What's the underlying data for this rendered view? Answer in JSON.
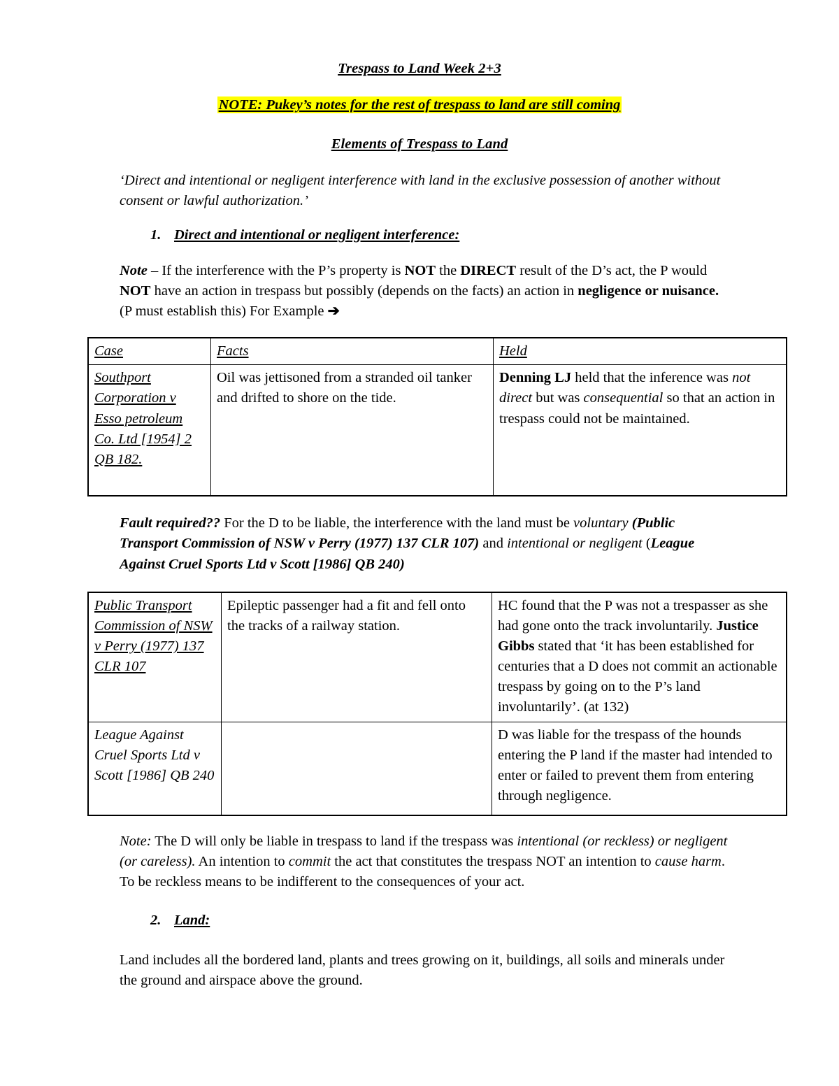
{
  "document": {
    "title": "Trespass to Land Week 2+3",
    "highlight_note": "NOTE: Pukey’s notes for the rest of trespass to land are still coming",
    "highlight_color": "#ffff00",
    "section_heading": "Elements of Trespass to Land",
    "definition_line1": "‘Direct and intentional or negligent interference with land in the exclusive possession of",
    "definition_line2": "another without consent or lawful authorization.’"
  },
  "elements": [
    {
      "number": "1.",
      "label": "Direct and intentional or negligent interference:"
    },
    {
      "number": "2.",
      "label": "Land:"
    }
  ],
  "note_paragraph": {
    "lead": "Note",
    "dash": " – If the interference with the P’s property is ",
    "not1": "NOT",
    "the": " the ",
    "direct": "DIRECT",
    "rest1": " result of the D’s act, the P would ",
    "not2": "NOT",
    "rest2": " have an action in trespass but possibly (depends on the facts) an action in ",
    "negligence": "negligence or nuisance.",
    "rest3": " (P must establish this) For Example ",
    "arrow": "➔"
  },
  "table_one": {
    "headers": [
      "Case",
      "Facts",
      "Held"
    ],
    "rows": [
      {
        "case": "Southport Corporation v Esso petroleum Co. Ltd [1954] 2 QB 182.",
        "facts": "Oil was jettisoned from a stranded oil tanker and drifted to shore on the tide.",
        "held_bold": "Denning LJ",
        "held_part1": " held that the inference was ",
        "held_italic1": "not direct",
        "held_part2": " but was ",
        "held_italic2": "consequential",
        "held_part3": " so that an action in trespass could not be maintained."
      }
    ]
  },
  "fault_paragraph": {
    "lead": "Fault required??",
    "part1": " For the D to be liable, the interference with the land must be ",
    "italic1": "voluntary",
    "cite1": "(Public Transport Commission of NSW v Perry (1977) 137 CLR 107)",
    "part2": " and ",
    "italic2": "intentional or negligent",
    "cite_open": " (",
    "cite2": "League Against Cruel Sports Ltd v Scott [1986] QB 240",
    "cite_close": ")"
  },
  "table_two": {
    "rows": [
      {
        "case": "Public Transport Commission of NSW v Perry (1977) 137 CLR 107",
        "case_underlined": true,
        "facts": "Epileptic passenger had a fit and fell onto the tracks of a railway station.",
        "held_part1": "HC found that the P was not a trespasser as she had gone onto the track involuntarily. ",
        "held_bold": "Justice Gibbs",
        "held_part2": " stated that ‘it has been established for centuries that a D does not commit an actionable trespass by going on to the P’s land involuntarily’. (at 132)"
      },
      {
        "case": "League Against Cruel Sports Ltd v Scott [1986] QB 240",
        "case_underlined": false,
        "facts": "",
        "held_part1": "D was liable for the trespass of the hounds entering the P land if the master had intended to enter or failed to prevent them from entering through negligence.",
        "held_bold": "",
        "held_part2": ""
      }
    ]
  },
  "note_two": {
    "lead": "Note:",
    "part1": " The D will only be liable in trespass to land if the trespass was ",
    "italic1": "intentional (or reckless) or negligent (or careless).",
    "part2": " An intention to ",
    "italic2": "commit",
    "part3": " the act that constitutes the trespass NOT an intention to ",
    "italic3": "cause harm",
    "part4": ". To be reckless means to be indifferent to the consequences of your act."
  },
  "land_paragraph": "Land includes all the bordered land, plants and trees growing on it, buildings, all soils and minerals under the ground and airspace above the ground."
}
